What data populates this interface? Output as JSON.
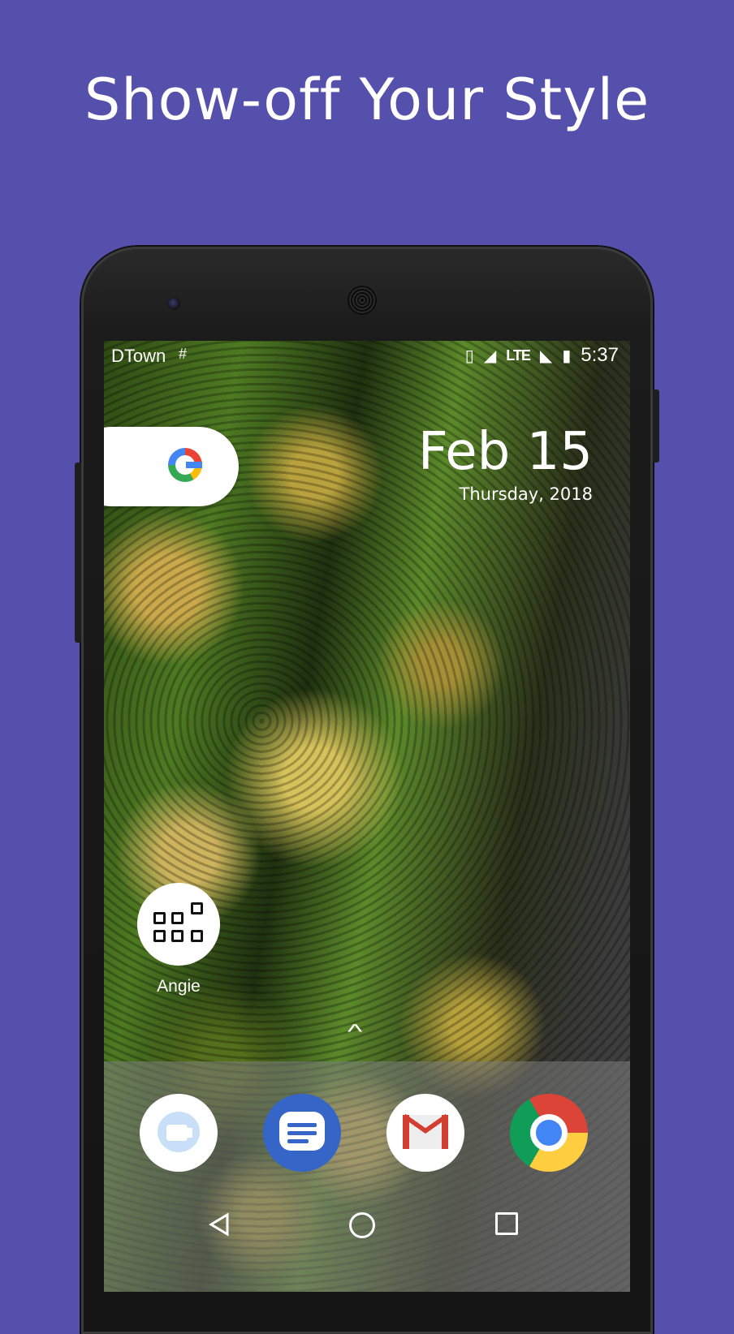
{
  "headline": "Show-off Your Style",
  "status_bar": {
    "carrier": "DTown",
    "network_type": "LTE",
    "time": "5:37",
    "icons": [
      "network-hash-icon",
      "vibrate-icon",
      "signal-icon",
      "wifi-off-icon",
      "battery-charging-icon"
    ]
  },
  "search_widget": {
    "icon": "google-g-icon"
  },
  "clock_widget": {
    "date": "Feb 15",
    "weekday_year": "Thursday, 2018"
  },
  "home_app": {
    "label": "Angie",
    "icon": "app-grid-icon"
  },
  "app_drawer_handle": "^",
  "dock": [
    {
      "name": "Duo",
      "icon": "duo-icon"
    },
    {
      "name": "Messages",
      "icon": "messages-icon"
    },
    {
      "name": "Gmail",
      "icon": "gmail-icon"
    },
    {
      "name": "Chrome",
      "icon": "chrome-icon"
    }
  ],
  "navigation": [
    "back-icon",
    "home-icon",
    "recents-icon"
  ],
  "colors": {
    "background": "#5450ab",
    "headline": "#ffffff"
  }
}
